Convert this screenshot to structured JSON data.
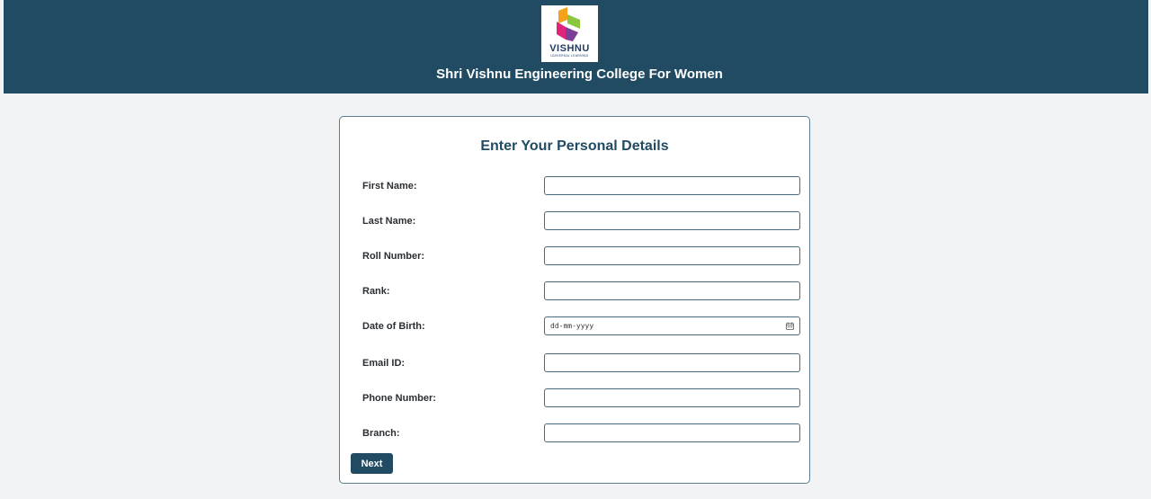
{
  "header": {
    "logo": {
      "wordmark": "VISHNU",
      "tagline": "UNIVERSAL LEARNING",
      "colors": [
        "#f5a11a",
        "#8cc63f",
        "#e2237b",
        "#7b3f98"
      ]
    },
    "college_name": "Shri Vishnu Engineering College For Women",
    "background": "#214b63"
  },
  "form": {
    "title": "Enter Your Personal Details",
    "fields": [
      {
        "label": "First Name:",
        "value": ""
      },
      {
        "label": "Last Name:",
        "value": ""
      },
      {
        "label": "Roll Number:",
        "value": ""
      },
      {
        "label": "Rank:",
        "value": ""
      },
      {
        "label": "Date of Birth:",
        "placeholder": "dd-mm-yyyy",
        "icon": "calendar-icon"
      },
      {
        "label": "Email ID:",
        "value": ""
      },
      {
        "label": "Phone Number:",
        "value": ""
      },
      {
        "label": "Branch:",
        "value": ""
      }
    ],
    "next_label": "Next"
  }
}
